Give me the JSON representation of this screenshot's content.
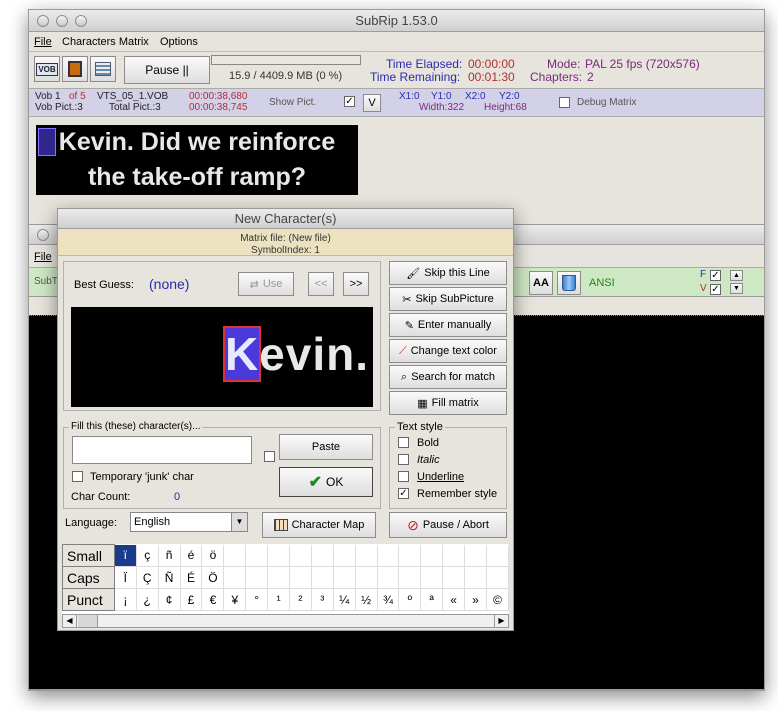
{
  "main": {
    "title": "SubRip 1.53.0",
    "menu": [
      "File",
      "Characters Matrix",
      "Options"
    ],
    "pause_label": "Pause ||",
    "size_text": "15.9 / 4409.9 MB (0 %)",
    "time_elapsed_label": "Time Elapsed:",
    "time_elapsed": "00:00:00",
    "time_remaining_label": "Time Remaining:",
    "time_remaining": "00:01:30",
    "mode_label": "Mode:",
    "mode": "PAL 25 fps (720x576)",
    "chapters_label": "Chapters:",
    "chapters": "2",
    "vob_line1_a": "Vob 1",
    "vob_line1_b": "of 5",
    "vob_line1_c": "VTS_05_1.VOB",
    "vob_line1_time": "00:00:38,680",
    "vob_line2_a": "Vob Pict.:3",
    "vob_line2_b": "Total Pict.:3",
    "vob_line2_time": "00:00:38,745",
    "show_pict_label": "Show Pict.",
    "v_button": "V",
    "x1": "X1:0",
    "y1": "Y1:0",
    "x2": "X2:0",
    "y2": "Y2:0",
    "width": "Width:322",
    "height": "Height:68",
    "debug_matrix": "Debug Matrix",
    "subtitle_line1": "Kevin. Did we reinforce",
    "subtitle_line2": "the take-off ramp?"
  },
  "second": {
    "menu_file": "File",
    "sub_label": "SubT",
    "ansi": "ANSI",
    "f_label": "F",
    "v_label": "V"
  },
  "dialog": {
    "title": "New Character(s)",
    "matrix_file": "Matrix file: (New file)",
    "symbol_index": "SymbolIndex: 1",
    "best_guess_label": "Best Guess:",
    "best_guess_value": "(none)",
    "use_label": "Use",
    "prev_label": "<<",
    "next_label": ">>",
    "preview_text_rest": "evin.",
    "preview_text_first": "K",
    "buttons": {
      "skip_line": "Skip this Line",
      "skip_subpicture": "Skip SubPicture",
      "enter_manually": "Enter manually",
      "change_color": "Change text color",
      "search_match": "Search for match",
      "fill_matrix": "Fill matrix"
    },
    "fill_group_label": "Fill this (these) character(s)...",
    "paste_label": "Paste",
    "ok_label": "OK",
    "temp_junk_label": "Temporary 'junk' char",
    "char_count_label": "Char Count:",
    "char_count_value": "0",
    "text_style_label": "Text style",
    "bold": "Bold",
    "italic": "Italic",
    "underline": "Underline",
    "remember_style": "Remember style",
    "language_label": "Language:",
    "language_value": "English",
    "character_map": "Character Map",
    "pause_abort": "Pause / Abort",
    "rows": [
      {
        "label": "Small",
        "chars": [
          "ï",
          "ç",
          "ñ",
          "é",
          "ö",
          "",
          "",
          "",
          "",
          "",
          "",
          "",
          "",
          "",
          "",
          "",
          "",
          ""
        ]
      },
      {
        "label": "Caps",
        "chars": [
          "Ï",
          "Ç",
          "Ñ",
          "É",
          "Ö",
          "",
          "",
          "",
          "",
          "",
          "",
          "",
          "",
          "",
          "",
          "",
          "",
          ""
        ]
      },
      {
        "label": "Punct",
        "chars": [
          "¡",
          "¿",
          "¢",
          "£",
          "€",
          "¥",
          "°",
          "¹",
          "²",
          "³",
          "¼",
          "½",
          "¾",
          "º",
          "ª",
          "«",
          "»",
          "©"
        ]
      }
    ]
  },
  "colors": {
    "label_blue": "#2b2bb0",
    "value_red": "#b03030",
    "mode_purple": "#7a2a7a",
    "ansi_green": "#1a8a1a",
    "highlight_k": "#4a3adb"
  }
}
